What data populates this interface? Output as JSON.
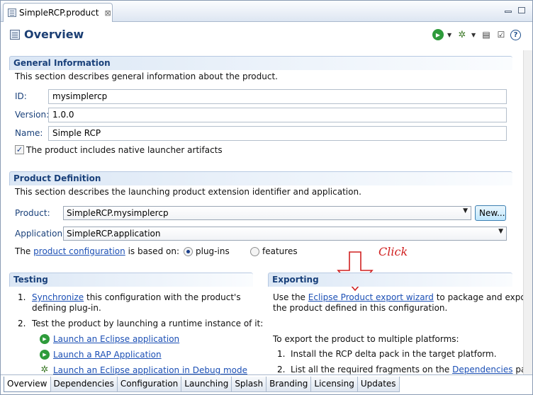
{
  "editor_tab": {
    "label": "SimpleRCP.product",
    "close": "⊠"
  },
  "header": {
    "title": "Overview"
  },
  "general": {
    "title": "General Information",
    "desc": "This section describes general information about the product.",
    "id_label": "ID:",
    "id_value": "mysimplercp",
    "version_label": "Version:",
    "version_value": "1.0.0",
    "name_label": "Name:",
    "name_value": "Simple RCP",
    "native_check": "The product includes native launcher artifacts"
  },
  "definition": {
    "title": "Product Definition",
    "desc": "This section describes the launching product extension identifier and application.",
    "product_label": "Product:",
    "product_value": "SimpleRCP.mysimplercp",
    "new_button": "New...",
    "application_label": "Application:",
    "application_value": "SimpleRCP.application",
    "config_prefix": "The",
    "config_link": "product configuration",
    "config_suffix": "is based on:",
    "opt_plugins": "plug-ins",
    "opt_features": "features"
  },
  "annotation": {
    "click": "Click"
  },
  "testing": {
    "title": "Testing",
    "item1_num": "1.",
    "item1_link": "Synchronize",
    "item1_text": "this configuration with the product's",
    "item1_text2": "defining plug-in.",
    "item2_num": "2.",
    "item2_text": "Test the product by launching a runtime instance of it:",
    "launch1": "Launch an Eclipse application",
    "launch2": "Launch a RAP Application",
    "launch3": "Launch an Eclipse application in Debug mode"
  },
  "exporting": {
    "title": "Exporting",
    "use_prefix": "Use the",
    "wizard_link": "Eclipse Product export wizard",
    "use_suffix": "to package and export",
    "use_line2": "the product defined in this configuration.",
    "multi": "To export the product to multiple platforms:",
    "step1_num": "1.",
    "step1": "Install the RCP delta pack in the target platform.",
    "step2_num": "2.",
    "step2_prefix": "List all the required fragments on the",
    "step2_link": "Dependencies",
    "step2_suffix": "page."
  },
  "bottom_tabs": [
    "Overview",
    "Dependencies",
    "Configuration",
    "Launching",
    "Splash",
    "Branding",
    "Licensing",
    "Updates"
  ],
  "colors": {
    "section_title": "#19407a",
    "link": "#1b4fb5",
    "annotation": "#d02020"
  }
}
